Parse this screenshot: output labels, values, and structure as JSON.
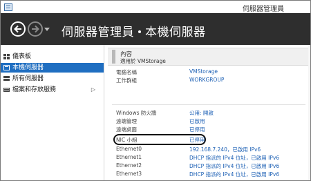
{
  "window": {
    "title": "伺服器管理員"
  },
  "header": {
    "breadcrumb": [
      "伺服器管理員",
      "本機伺服器"
    ],
    "separator": "▸"
  },
  "sidebar": {
    "items": [
      {
        "label": "儀表板",
        "icon": "dashboard-icon"
      },
      {
        "label": "本機伺服器",
        "icon": "server-icon",
        "active": true
      },
      {
        "label": "所有伺服器",
        "icon": "servers-icon"
      },
      {
        "label": "檔案和存放服務",
        "icon": "storage-icon",
        "has_children": true,
        "chevron": "▷"
      }
    ]
  },
  "properties": {
    "title": "內容",
    "subtitle": "適用於 VMStorage",
    "rows_top": [
      {
        "label": "電腦名稱",
        "value": "VMStorage"
      },
      {
        "label": "工作群組",
        "value": "WORKGROUP"
      }
    ],
    "rows_bottom": [
      {
        "label": "Windows 防火牆",
        "value": "公用: 開啟"
      },
      {
        "label": "遠端管理",
        "value": "已啟用"
      },
      {
        "label": "遠端桌面",
        "value": "已停用"
      },
      {
        "label": "NIC 小組",
        "value": "已停用",
        "highlighted": true
      },
      {
        "label": "Ethernet0",
        "value": "192.168.7.240，已啟用 IPv6"
      },
      {
        "label": "Ethernet1",
        "value": "DHCP 指派的 IPv4 位址，已啟用 IPv6"
      },
      {
        "label": "Ethernet2",
        "value": "DHCP 指派的 IPv4 位址，已啟用 IPv6"
      },
      {
        "label": "Ethernet3",
        "value": "DHCP 指派的 IPv4 位址，已啟用 IPv6"
      }
    ]
  },
  "colors": {
    "header_bg": "#2e2e2e",
    "active_item": "#1f6ec1",
    "link": "#1b5fb4"
  }
}
